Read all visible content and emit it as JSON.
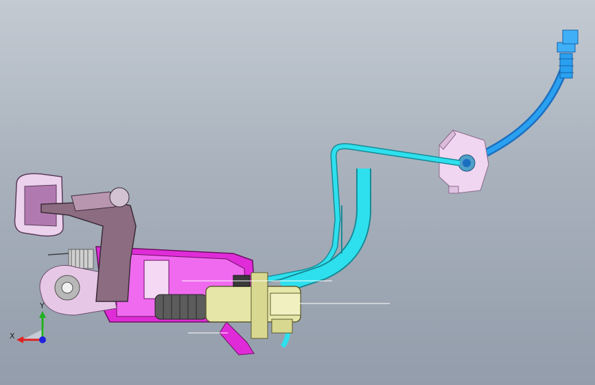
{
  "viewport": {
    "background_top": "#c3cad2",
    "background_bottom": "#939dab"
  },
  "triad": {
    "x_label": "X",
    "y_label": "Y",
    "x_color": "#e02020",
    "y_color": "#20b020",
    "z_color": "#2020e0"
  },
  "parts": [
    {
      "name": "pedal-pad",
      "color": "#e6c8e6"
    },
    {
      "name": "pedal-arm",
      "color": "#8a7080"
    },
    {
      "name": "pedal-bracket",
      "color": "#d020c8"
    },
    {
      "name": "master-cylinder",
      "color": "#e6e6a8"
    },
    {
      "name": "boot",
      "color": "#5a5a5a"
    },
    {
      "name": "hydraulic-tube",
      "color": "#20d8e8"
    },
    {
      "name": "reservoir-bracket",
      "color": "#f0c8f0"
    },
    {
      "name": "flex-hose",
      "color": "#1e90e8"
    }
  ]
}
